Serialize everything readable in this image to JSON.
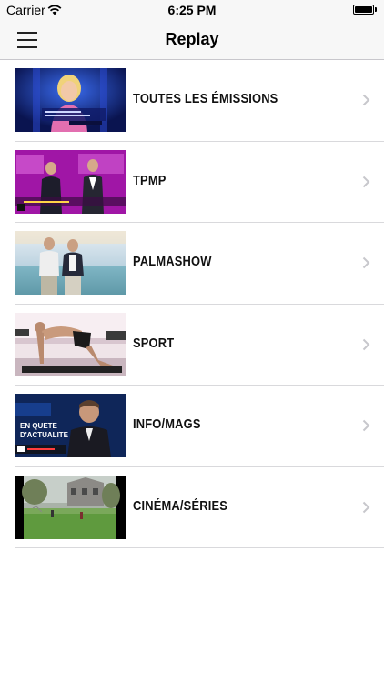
{
  "status_bar": {
    "carrier": "Carrier",
    "wifi_icon": "wifi-icon",
    "time": "6:25 PM",
    "battery_icon": "battery-full-icon"
  },
  "nav": {
    "menu_icon": "hamburger-menu-icon",
    "title": "Replay"
  },
  "categories": [
    {
      "label": "TOUTES LES ÉMISSIONS",
      "thumbnail": "studio-host-thumbnail"
    },
    {
      "label": "TPMP",
      "thumbnail": "tpmp-show-thumbnail"
    },
    {
      "label": "PALMASHOW",
      "thumbnail": "palmashow-beach-thumbnail"
    },
    {
      "label": "SPORT",
      "thumbnail": "fitness-exercise-thumbnail"
    },
    {
      "label": "INFO/MAGS",
      "thumbnail": "news-magazine-thumbnail"
    },
    {
      "label": "CINÉMA/SÉRIES",
      "thumbnail": "movie-scene-thumbnail"
    }
  ],
  "chevron_icon": "chevron-right-icon",
  "thumbnail_texts": {
    "info_mags_line1": "EN QUETE",
    "info_mags_line2": "D'ACTUALITE"
  },
  "colors": {
    "bar_background": "#f7f7f7",
    "separator": "#d9d9dc",
    "chevron": "#c7c7cc"
  }
}
